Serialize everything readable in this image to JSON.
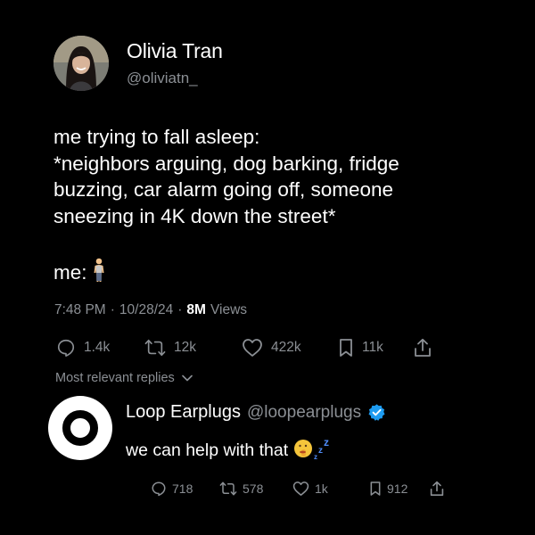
{
  "tweet": {
    "author": {
      "name": "Olivia Tran",
      "handle": "@oliviatn_"
    },
    "text": "me trying to fall asleep:\n*neighbors arguing, dog barking, fridge buzzing, car alarm going off, someone sneezing in 4K down the street*",
    "me_label": "me:",
    "me_emoji_icon": "standing-person-icon",
    "time": "7:48 PM",
    "date": "10/28/24",
    "separator": "·",
    "views_count": "8M",
    "views_label": "Views",
    "actions": {
      "replies": "1.4k",
      "retweets": "12k",
      "likes": "422k",
      "bookmarks": "11k"
    }
  },
  "replies_sort": {
    "label": "Most relevant replies"
  },
  "reply": {
    "name": "Loop Earplugs",
    "handle": "@loopearplugs",
    "verified": true,
    "text": "we can help with that",
    "emoji_icon": "shushing-face-zzz-icon",
    "actions": {
      "replies": "718",
      "retweets": "578",
      "likes": "1k",
      "bookmarks": "912"
    }
  },
  "colors": {
    "background": "#000000",
    "text": "#ffffff",
    "muted": "#8b8f94",
    "verified": "#1d9bf0"
  }
}
